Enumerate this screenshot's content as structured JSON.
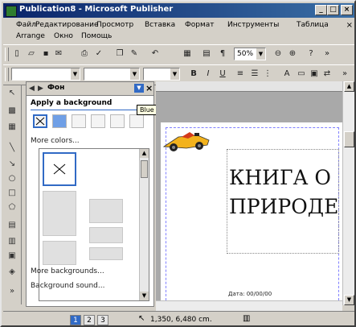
{
  "window": {
    "title": "Publication8 - Microsoft Publisher"
  },
  "controls": {
    "minimize": "_",
    "maximize": "□",
    "close": "×"
  },
  "menu": {
    "row1": [
      "Файл",
      "Редактирование",
      "Просмотр",
      "Вставка",
      "Формат",
      "Инструменты",
      "Таблица"
    ],
    "row2": [
      "Arrange",
      "Окно",
      "Помощь"
    ]
  },
  "toolbar": {
    "zoom": "50%"
  },
  "taskpane": {
    "title": "Фон",
    "section": "Apply a background",
    "more_colors": "More colors...",
    "more_backgrounds": "More backgrounds...",
    "background_sound": "Background sound..."
  },
  "tooltip": "Blue Tint, Ratios",
  "document": {
    "title_line1": "КНИГА О",
    "title_line2": "ПРИРОДЕ",
    "date": "Дата: 00/00/00"
  },
  "statusbar": {
    "pages": [
      "1",
      "2",
      "3"
    ],
    "coords": "1,350, 6,480 cm."
  },
  "colors": {
    "titlebar": "#0a246a",
    "accent": "#316ac5",
    "face": "#d4d0c8"
  }
}
